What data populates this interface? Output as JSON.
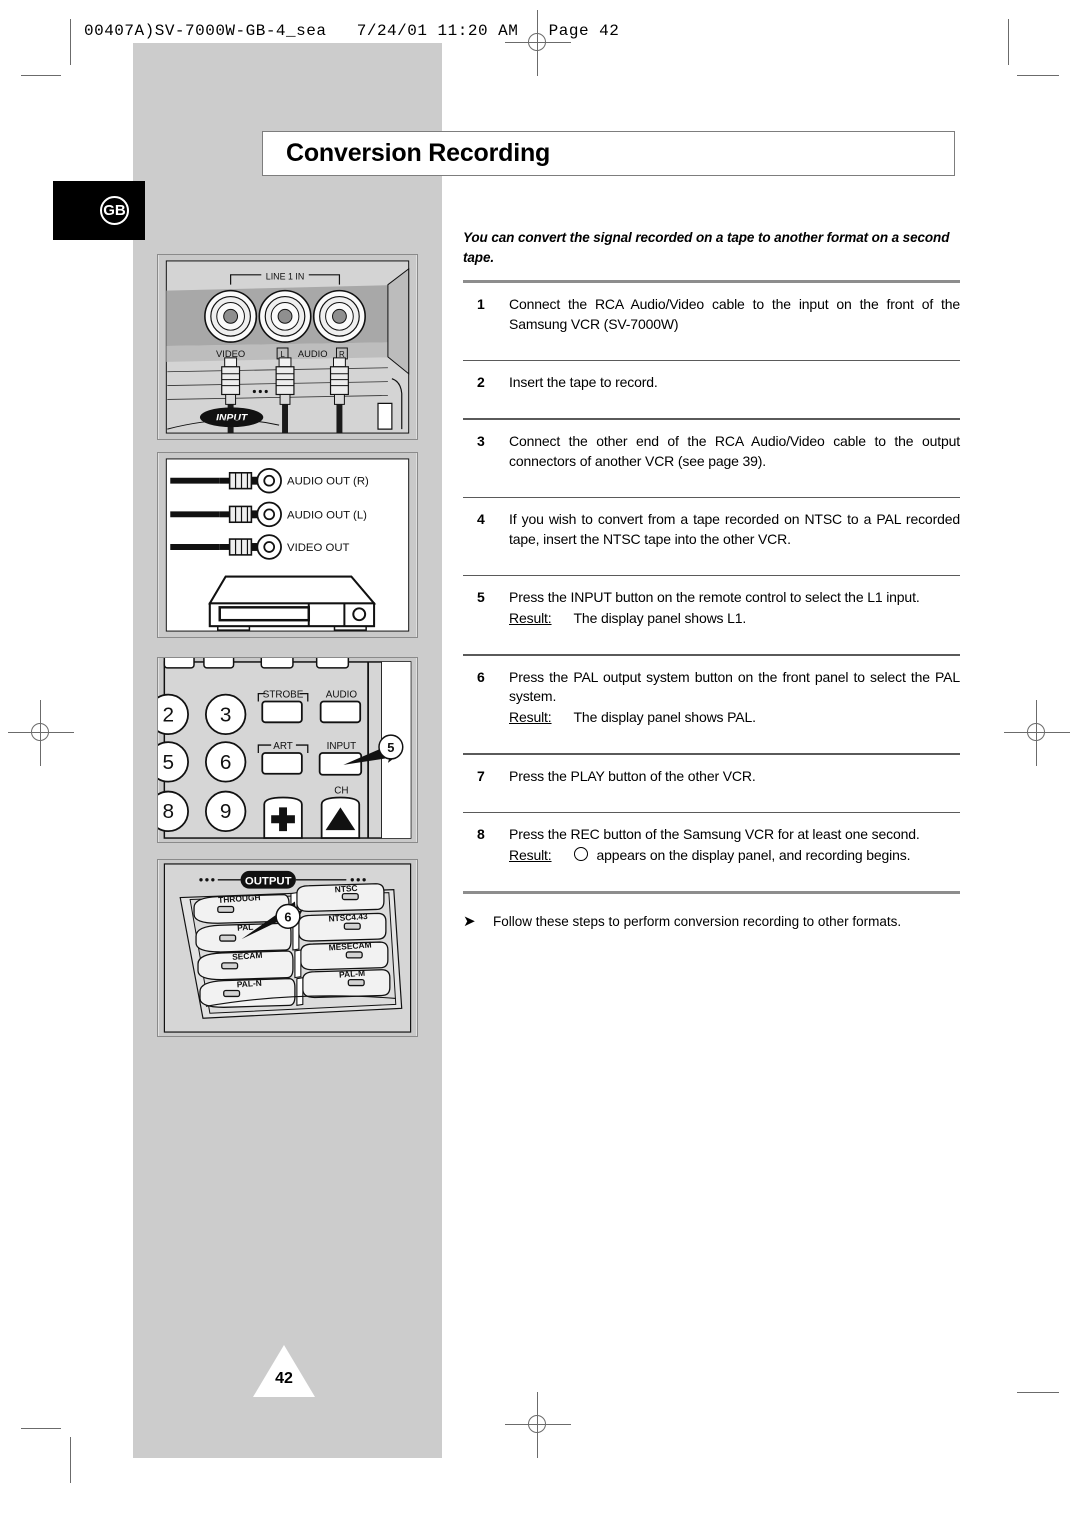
{
  "header": {
    "filename": "00407A)SV-7000W-GB-4_sea   7/24/01 11:20 AM   Page 42"
  },
  "badge": {
    "region": "GB"
  },
  "title": "Conversion Recording",
  "intro": "You can convert the signal recorded on a tape to another format on a second tape.",
  "steps": [
    {
      "num": "1",
      "text": "Connect the RCA Audio/Video cable to the input on the front of the Samsung VCR (SV-7000W)"
    },
    {
      "num": "2",
      "text": "Insert the tape to record."
    },
    {
      "num": "3",
      "text": "Connect the other end of the RCA Audio/Video cable to the output connectors of another VCR (see page 39)."
    },
    {
      "num": "4",
      "text": "If you wish to convert from a tape recorded on NTSC to a PAL recorded tape, insert the NTSC tape into the other VCR."
    },
    {
      "num": "5",
      "text": "Press the INPUT button on the remote control to select the L1 input.",
      "result_label": "Result:",
      "result_text": "The display panel shows L1."
    },
    {
      "num": "6",
      "text": "Press the PAL output system button on the front panel to select the PAL system.",
      "result_label": "Result:",
      "result_text": "The display panel shows PAL."
    },
    {
      "num": "7",
      "text": "Press the PLAY button of the other VCR."
    },
    {
      "num": "8",
      "text": "Press the REC button of the Samsung VCR for at least one second.",
      "result_label": "Result:",
      "result_icon": "circle-o-icon",
      "result_text": "appears on the display panel, and recording begins."
    }
  ],
  "note": {
    "bullet": "➤",
    "text": "Follow these steps to perform conversion recording to other formats."
  },
  "figures": {
    "line1in": {
      "caption": "LINE 1 IN",
      "jack_labels": [
        "VIDEO",
        "L",
        "AUDIO",
        "R"
      ],
      "input_tag": "INPUT"
    },
    "vcr_outputs": {
      "connector_labels": [
        "AUDIO OUT (R)",
        "AUDIO OUT (L)",
        "VIDEO OUT"
      ]
    },
    "remote": {
      "keys": [
        "2",
        "3",
        "5",
        "6",
        "8",
        "9"
      ],
      "buttons": [
        "STROBE",
        "AUDIO",
        "ART",
        "INPUT",
        "CH"
      ],
      "plus_key": "+",
      "up_key": "▲",
      "callout": "5"
    },
    "output_panel": {
      "title": "OUTPUT",
      "buttons": [
        "THROUGH",
        "NTSC",
        "PAL",
        "NTSC4.43",
        "SECAM",
        "MESECAM",
        "PAL-N",
        "PAL-M"
      ],
      "callout": "6"
    }
  },
  "page_number": "42",
  "colors": {
    "band_gray": "#cccccc",
    "rule_gray": "#8d8d8d",
    "badge_black": "#000000"
  }
}
